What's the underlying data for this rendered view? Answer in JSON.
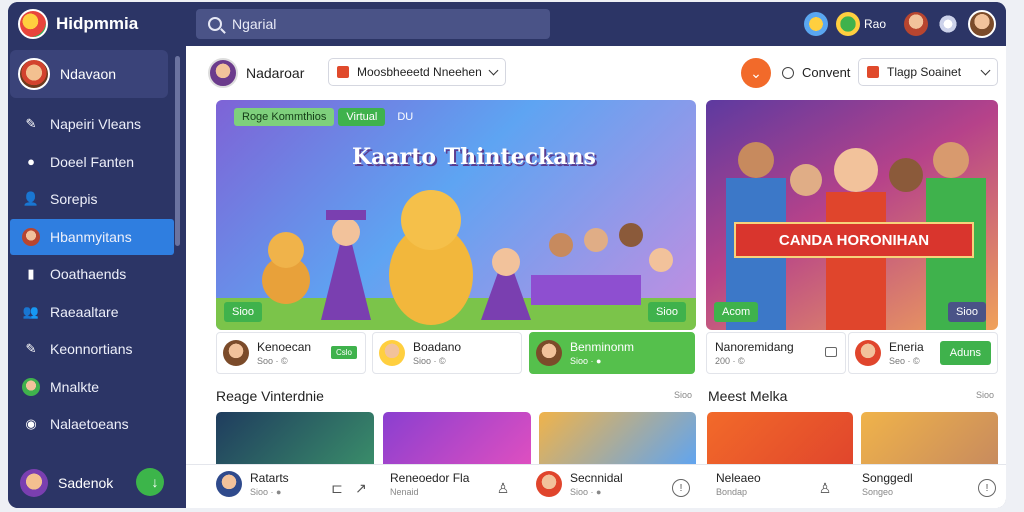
{
  "app": {
    "name": "Hidpmmia"
  },
  "search": {
    "placeholder": "Ngarial"
  },
  "top_right": {
    "label": "Rao"
  },
  "sidebar": {
    "profile": "Ndavaon",
    "items": [
      {
        "label": "Napeiri Vleans",
        "icon": "pencil-icon"
      },
      {
        "label": "Doeel Fanten",
        "icon": "chat-bubble-icon"
      },
      {
        "label": "Sorepis",
        "icon": "person-icon"
      },
      {
        "label": "Hbanmyitans",
        "icon": "avatar-icon",
        "active": true
      },
      {
        "label": "Ooathaends",
        "icon": "chat-bubble-icon"
      },
      {
        "label": "Raeaaltare",
        "icon": "people-icon"
      },
      {
        "label": "Keonnortians",
        "icon": "pencil-icon"
      },
      {
        "label": "Mnalkte",
        "icon": "avatar-icon"
      },
      {
        "label": "Nalaetoeans",
        "icon": "compass-icon"
      }
    ],
    "bottom": "Sadenok"
  },
  "main": {
    "header": {
      "title": "Nadaroar",
      "dropdown1": "Moosbheeetd Nneehen",
      "convert": "Convent",
      "dropdown2": "Tlagp Soainet"
    },
    "hero": {
      "tags": [
        "Roge Kommthios",
        "Virtual",
        "DU"
      ],
      "title": "Kaarto Thinteckans",
      "badge_left": "Sioo",
      "badge_right": "Sioo"
    },
    "side_hero": {
      "banner": "CANDA HORONIHAN",
      "badge_left": "Acom",
      "badge_right": "Sioo"
    },
    "cards": [
      {
        "title": "Kenoecan",
        "sub": "Soo · ©",
        "button": "Cslo"
      },
      {
        "title": "Boadano",
        "sub": "Sioo · ©"
      },
      {
        "title": "Benminonm",
        "sub": "Sioo · ●",
        "highlight": true
      },
      {
        "title": "Nanoremidang",
        "sub": "200 · ©"
      },
      {
        "title": "Eneria",
        "sub": "Seo · ©",
        "button": "Aduns"
      }
    ],
    "section1": {
      "title": "Reage Vinterdnie",
      "more": "Sioo"
    },
    "section2": {
      "title": "Meest Melka",
      "more": "Sioo"
    },
    "bottom_items": [
      {
        "title": "Ratarts",
        "sub": "Sioo · ●"
      },
      {
        "title": "Reneoedor Fla",
        "sub": "Nenaid"
      },
      {
        "title": "Secnnidal",
        "sub": "Sioo · ●"
      },
      {
        "title": "Neleaeo",
        "sub": "Bondap"
      },
      {
        "title": "Songgedl",
        "sub": "Songeo"
      }
    ]
  },
  "colors": {
    "sidebar_bg": "#2c3566",
    "active_item": "#2f7ee0",
    "accent_green": "#3fb24c",
    "accent_orange": "#f26a2a",
    "banner_red": "#d9352d"
  }
}
